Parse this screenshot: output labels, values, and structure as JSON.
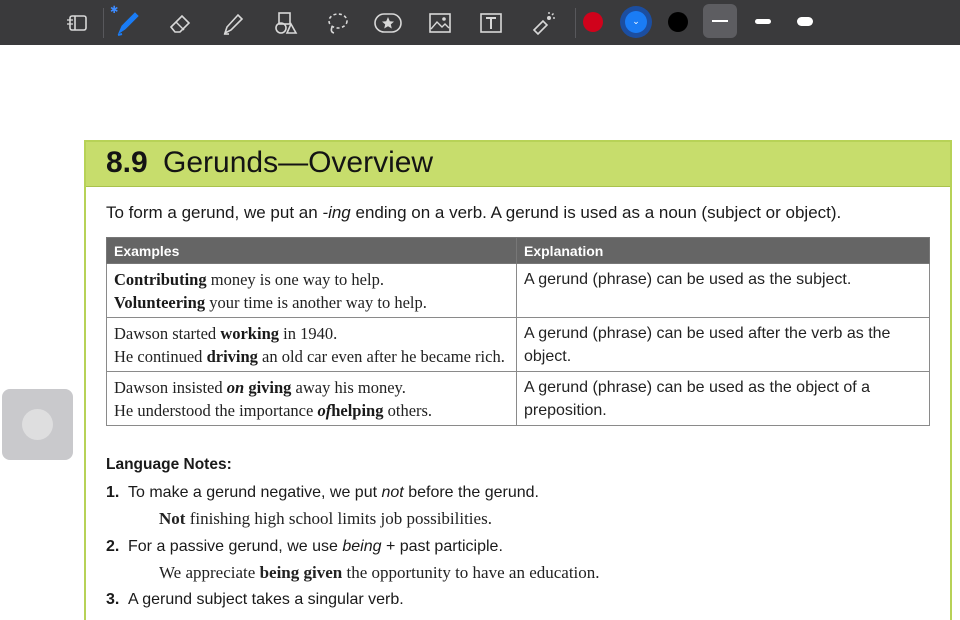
{
  "toolbar": {
    "tools": [
      {
        "name": "reader-toggle",
        "icon": "sidebar-book-icon"
      },
      {
        "name": "pen-tool",
        "icon": "pen-icon",
        "selected": true
      },
      {
        "name": "eraser-tool",
        "icon": "eraser-icon"
      },
      {
        "name": "highlighter-tool",
        "icon": "highlighter-icon"
      },
      {
        "name": "shapes-tool",
        "icon": "shapes-icon"
      },
      {
        "name": "lasso-tool",
        "icon": "lasso-icon"
      },
      {
        "name": "sticker-tool",
        "icon": "star-sticker-icon"
      },
      {
        "name": "image-tool",
        "icon": "image-icon"
      },
      {
        "name": "text-tool",
        "icon": "text-box-icon"
      },
      {
        "name": "laser-tool",
        "icon": "laser-pointer-icon"
      }
    ],
    "bluetooth_icon": "bluetooth-icon",
    "colors": [
      "#d0021b",
      "#1a7cf5",
      "#000000"
    ],
    "selected_color": "#1a7cf5",
    "stroke_sizes": [
      "thin",
      "medium",
      "thick"
    ],
    "selected_stroke": "thin"
  },
  "document": {
    "section_number": "8.9",
    "section_title": "Gerunds—Overview",
    "intro": {
      "before": "To form a gerund, we put an ",
      "italic": "-ing",
      "after": " ending on a verb. A gerund is used as a noun (subject or object)."
    },
    "table": {
      "headers": [
        "Examples",
        "Explanation"
      ],
      "rows": [
        {
          "examples": [
            [
              {
                "b": "Contributing"
              },
              {
                "t": " money is one way to help."
              }
            ],
            [
              {
                "b": "Volunteering"
              },
              {
                "t": " your time is another way to help."
              }
            ]
          ],
          "explanation": "A gerund (phrase) can be used as the subject."
        },
        {
          "examples": [
            [
              {
                "t": "Dawson started "
              },
              {
                "b": "working"
              },
              {
                "t": " in 1940."
              }
            ],
            [
              {
                "t": "He continued "
              },
              {
                "b": "driving"
              },
              {
                "t": " an old car even after he became rich."
              }
            ]
          ],
          "explanation": "A gerund (phrase) can be used after the verb as the object."
        },
        {
          "examples": [
            [
              {
                "t": "Dawson insisted "
              },
              {
                "bi": "on"
              },
              {
                "t": " "
              },
              {
                "b": "giving"
              },
              {
                "t": " away his money."
              }
            ],
            [
              {
                "t": "He understood the importance "
              },
              {
                "bi": "of"
              },
              {
                "b": "helping"
              },
              {
                "t": " others."
              }
            ]
          ],
          "explanation": "A gerund (phrase) can be used as the object of a preposition."
        }
      ]
    },
    "language_notes_title": "Language Notes:",
    "notes": [
      {
        "num": "1.",
        "text_before": "To make a gerund negative, we put ",
        "italic": "not",
        "text_after": " before the gerund.",
        "example_bold": "Not",
        "example_rest": " finishing high school limits job possibilities."
      },
      {
        "num": "2.",
        "text_before": "For a passive gerund, we use ",
        "italic": "being",
        "text_after": " + past participle.",
        "example_pre": "We appreciate ",
        "example_bold": "being given",
        "example_rest": " the opportunity to have an education."
      },
      {
        "num": "3.",
        "text_before": "A gerund subject takes a singular verb.",
        "italic": "",
        "text_after": ""
      }
    ]
  }
}
